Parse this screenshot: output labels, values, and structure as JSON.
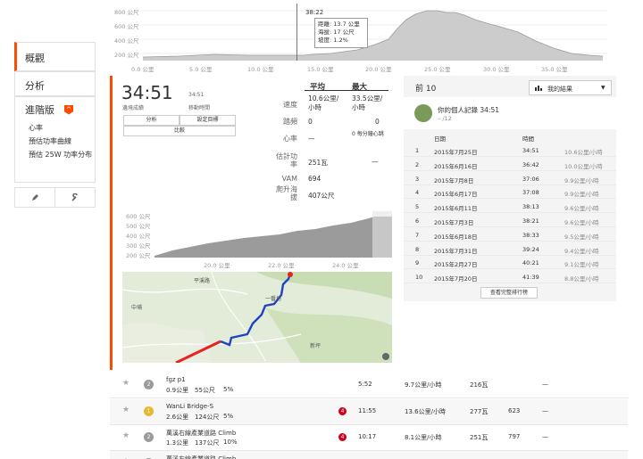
{
  "sidebar": {
    "overview": "概觀",
    "analysis": "分析",
    "advanced": "進階版",
    "advanced_badge": "^",
    "sub_items": [
      "心率",
      "預估功率曲線",
      "預估 25W 功率分布"
    ]
  },
  "top_chart": {
    "y_ticks": [
      "800 公尺",
      "600 公尺",
      "400 公尺",
      "200 公尺"
    ],
    "x_ticks": [
      "0.0 公里",
      "5.0 公里",
      "10.0 公里",
      "15.0 公里",
      "20.0 公里",
      "25.0 公里",
      "30.0 公里",
      "35.0 公里"
    ],
    "tooltip": {
      "time": "38:22",
      "distance": "距離: 13.7 公里",
      "elevation": "海拔: 17 公尺",
      "grade": "坡度: 1.2%"
    }
  },
  "effort": {
    "elapsed_time": "34:51",
    "elapsed_label": "邊境成績",
    "moving_time": "34:51",
    "moving_label": "移動時間",
    "btn_analysis": "分析",
    "btn_set_goal": "設定目標",
    "btn_compare": "比較",
    "col_avg": "平均",
    "col_max": "最大",
    "stats": [
      {
        "label": "速度",
        "avg": "10.6公里/小時",
        "max": "33.5公里/小時"
      },
      {
        "label": "踏頻",
        "avg": "0",
        "max": "0"
      },
      {
        "label": "心率",
        "avg": "—",
        "max": "0 每分鐘心跳"
      },
      {
        "label": "估計功率",
        "avg": "251瓦",
        "max": "—"
      },
      {
        "label": "VAM",
        "avg": "694",
        "max": ""
      },
      {
        "label": "爬升海拔",
        "avg": "407公尺",
        "max": ""
      }
    ]
  },
  "mini_chart": {
    "y_ticks": [
      "600 公尺",
      "500 公尺",
      "400 公尺",
      "300 公尺",
      "200 公尺"
    ],
    "x_ticks": [
      "20.0 公里",
      "22.0 公里",
      "24.0 公里"
    ]
  },
  "map": {
    "labels": [
      "平溪路",
      "中埔",
      "新坪",
      "一番地"
    ]
  },
  "leaderboard": {
    "title": "前 10",
    "dropdown": "我的結果",
    "pr_title": "你的個人記錄 34:51",
    "pr_sub": "– /12",
    "col_date": "日期",
    "col_time": "時間",
    "rows": [
      {
        "rank": "1",
        "date": "2015年7月25日",
        "time": "34:51",
        "speed": "10.6公里/小時"
      },
      {
        "rank": "2",
        "date": "2015年6月16日",
        "time": "36:42",
        "speed": "10.0公里/小時"
      },
      {
        "rank": "3",
        "date": "2015年7月8日",
        "time": "37:06",
        "speed": "9.9公里/小時"
      },
      {
        "rank": "4",
        "date": "2015年6月17日",
        "time": "37:08",
        "speed": "9.9公里/小時"
      },
      {
        "rank": "5",
        "date": "2015年6月11日",
        "time": "38:13",
        "speed": "9.6公里/小時"
      },
      {
        "rank": "6",
        "date": "2015年7月3日",
        "time": "38:21",
        "speed": "9.6公里/小時"
      },
      {
        "rank": "7",
        "date": "2015年6月18日",
        "time": "38:33",
        "speed": "9.5公里/小時"
      },
      {
        "rank": "8",
        "date": "2015年7月31日",
        "time": "39:24",
        "speed": "9.4公里/小時"
      },
      {
        "rank": "9",
        "date": "2015年2月27日",
        "time": "40:21",
        "speed": "9.1公里/小時"
      },
      {
        "rank": "10",
        "date": "2015年7月20日",
        "time": "41:39",
        "speed": "8.8公里/小時"
      }
    ],
    "see_all": "查看完整排行榜"
  },
  "segments": [
    {
      "medal": "2",
      "medal_color": "#9b9b9b",
      "name": "fgz p1",
      "dist": "0.9公里",
      "elev": "55公尺",
      "grade": "5%",
      "badge": "",
      "time": "5:52",
      "speed": "9.7公里/小時",
      "power": "216瓦",
      "vam": "",
      "hr": "—"
    },
    {
      "medal": "1",
      "medal_color": "#e8b92e",
      "name": "WanLi Bridge-S",
      "dist": "2.6公里",
      "elev": "124公尺",
      "grade": "5%",
      "badge": "4",
      "time": "11:55",
      "speed": "13.6公里/小時",
      "power": "277瓦",
      "vam": "623",
      "hr": "—"
    },
    {
      "medal": "2",
      "medal_color": "#9b9b9b",
      "name": "萬溪右線產業道路 Climb",
      "dist": "1.3公里",
      "elev": "137公尺",
      "grade": "10%",
      "badge": "4",
      "time": "10:17",
      "speed": "8.1公里/小時",
      "power": "251瓦",
      "vam": "797",
      "hr": "—"
    },
    {
      "medal": "2",
      "medal_color": "#9b9b9b",
      "name": "萬溪右線產業道路 Climb",
      "dist": "",
      "elev": "",
      "grade": "",
      "badge": "4",
      "time": "5:56",
      "speed": "11.3公里/小時",
      "power": "",
      "vam": "867",
      "hr": ""
    }
  ]
}
